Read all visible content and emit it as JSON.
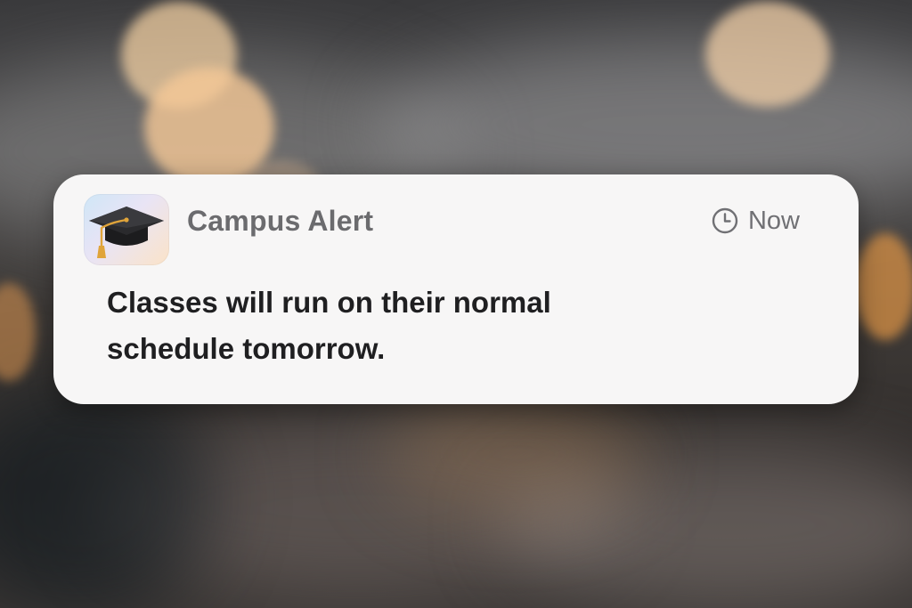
{
  "notification": {
    "app_icon": "graduation-cap-icon",
    "app_name": "Campus Alert",
    "time_icon": "clock-icon",
    "time": "Now",
    "message": "Classes will run on their normal schedule tomorrow."
  },
  "colors": {
    "card_background": "#f7f6f6",
    "title_text": "#6b6b6e",
    "message_text": "#1f1f21",
    "time_text": "#707074",
    "cap_black": "#1c1c1e",
    "tassel_gold": "#e0a43a"
  }
}
